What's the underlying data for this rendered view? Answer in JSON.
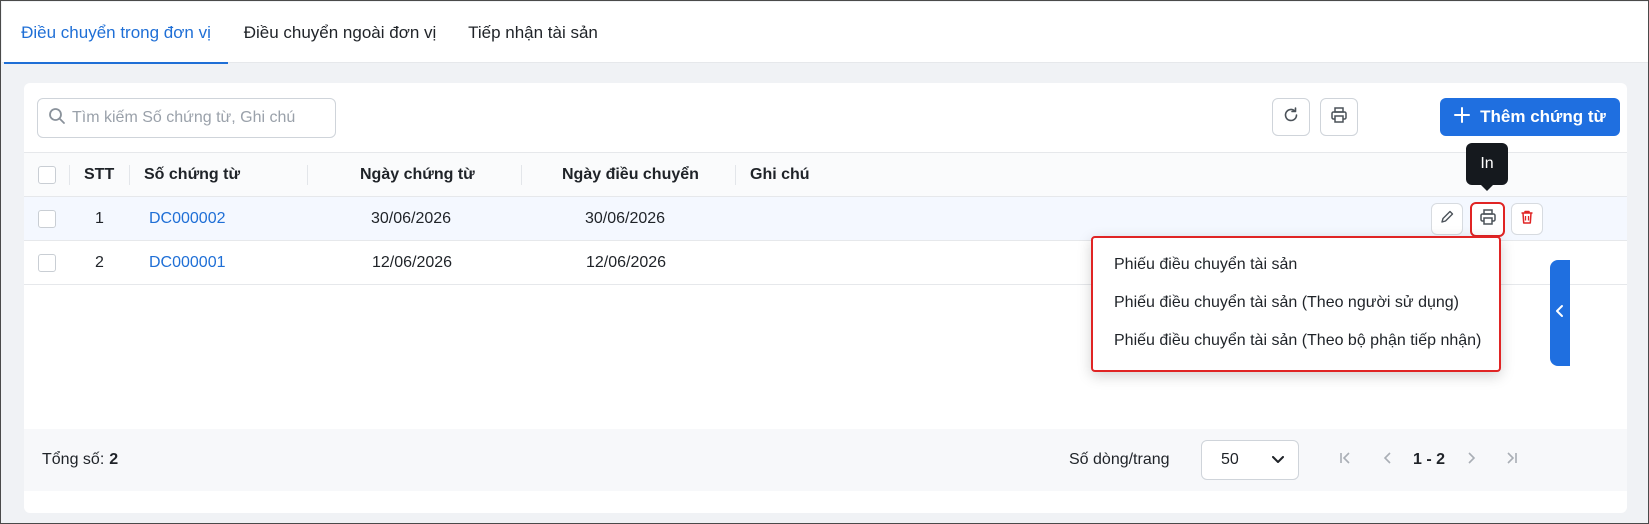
{
  "tabs": [
    {
      "label": "Điều chuyển trong đơn vị",
      "active": true
    },
    {
      "label": "Điều chuyển ngoài đơn vị",
      "active": false
    },
    {
      "label": "Tiếp nhận tài sản",
      "active": false
    }
  ],
  "toolbar": {
    "search_placeholder": "Tìm kiếm Số chứng từ, Ghi chú",
    "add_label": "Thêm chứng từ",
    "refresh_icon": "refresh-icon",
    "print_icon": "printer-icon"
  },
  "table": {
    "columns": [
      "STT",
      "Số chứng từ",
      "Ngày chứng từ",
      "Ngày điều chuyển",
      "Ghi chú"
    ],
    "rows": [
      {
        "stt": "1",
        "code": "DC000002",
        "doc_date": "30/06/2026",
        "transfer_date": "30/06/2026",
        "note": ""
      },
      {
        "stt": "2",
        "code": "DC000001",
        "doc_date": "12/06/2026",
        "transfer_date": "12/06/2026",
        "note": ""
      }
    ]
  },
  "tooltip": {
    "text": "In"
  },
  "print_menu": {
    "items": [
      "Phiếu điều chuyển tài sản",
      "Phiếu điều chuyển tài sản (Theo người sử dụng)",
      "Phiếu điều chuyển tài sản (Theo bộ phận tiếp nhận)"
    ]
  },
  "footer": {
    "total_label": "Tổng số:",
    "total_value": "2",
    "rows_per_page_label": "Số dòng/trang",
    "rows_per_page_value": "50",
    "page_range": "1 - 2"
  },
  "colors": {
    "accent": "#1f6fe0",
    "highlight": "#e02424",
    "link": "#1f6fd6"
  }
}
